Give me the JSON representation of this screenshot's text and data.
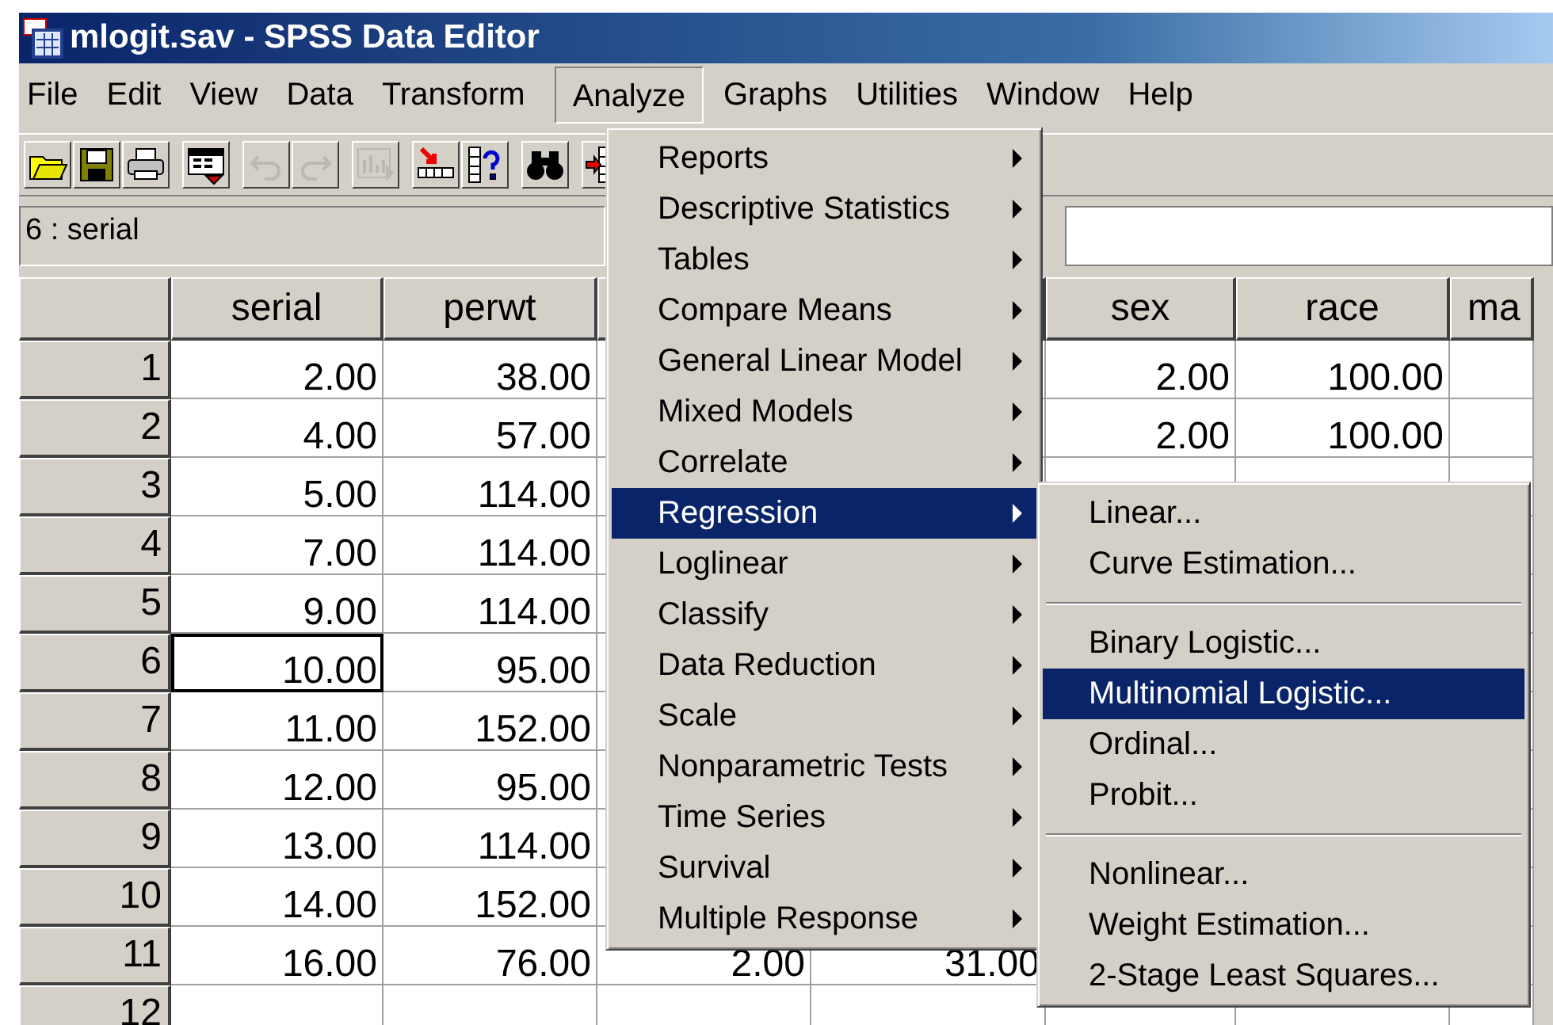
{
  "window": {
    "title": "mlogit.sav - SPSS Data Editor"
  },
  "menubar": [
    {
      "label": "File",
      "selected": false
    },
    {
      "label": "Edit",
      "selected": false
    },
    {
      "label": "View",
      "selected": false
    },
    {
      "label": "Data",
      "selected": false
    },
    {
      "label": "Transform",
      "selected": false
    },
    {
      "label": "Analyze",
      "selected": true
    },
    {
      "label": "Graphs",
      "selected": false
    },
    {
      "label": "Utilities",
      "selected": false
    },
    {
      "label": "Window",
      "selected": false
    },
    {
      "label": "Help",
      "selected": false
    }
  ],
  "toolbar": [
    {
      "kind": "open",
      "disabled": false
    },
    {
      "kind": "save",
      "disabled": false
    },
    {
      "kind": "print",
      "disabled": false
    },
    {
      "kind": "dialog",
      "disabled": false
    },
    {
      "kind": "undo",
      "disabled": true
    },
    {
      "kind": "redo",
      "disabled": true
    },
    {
      "kind": "chart",
      "disabled": true
    },
    {
      "kind": "goto",
      "disabled": false
    },
    {
      "kind": "variables",
      "disabled": false
    },
    {
      "kind": "find",
      "disabled": false
    },
    {
      "kind": "insert",
      "disabled": false
    }
  ],
  "cell_editor": {
    "reference": "6 : serial"
  },
  "grid": {
    "columns": [
      "serial",
      "perwt",
      null,
      null,
      "sex",
      "race",
      "ma"
    ],
    "rows": [
      {
        "label": "1",
        "focused": false,
        "cells": [
          "2.00",
          "38.00",
          null,
          null,
          "2.00",
          "100.00",
          null
        ]
      },
      {
        "label": "2",
        "focused": false,
        "cells": [
          "4.00",
          "57.00",
          null,
          null,
          "2.00",
          "100.00",
          null
        ]
      },
      {
        "label": "3",
        "focused": false,
        "cells": [
          "5.00",
          "114.00",
          null,
          null,
          null,
          null,
          null
        ]
      },
      {
        "label": "4",
        "focused": false,
        "cells": [
          "7.00",
          "114.00",
          null,
          null,
          null,
          null,
          null
        ]
      },
      {
        "label": "5",
        "focused": false,
        "cells": [
          "9.00",
          "114.00",
          null,
          null,
          null,
          null,
          null
        ]
      },
      {
        "label": "6",
        "focused": true,
        "cells": [
          "10.00",
          "95.00",
          null,
          null,
          null,
          null,
          null
        ]
      },
      {
        "label": "7",
        "focused": false,
        "cells": [
          "11.00",
          "152.00",
          null,
          null,
          null,
          null,
          null
        ]
      },
      {
        "label": "8",
        "focused": false,
        "cells": [
          "12.00",
          "95.00",
          null,
          null,
          null,
          null,
          null
        ]
      },
      {
        "label": "9",
        "focused": false,
        "cells": [
          "13.00",
          "114.00",
          null,
          null,
          null,
          null,
          null
        ]
      },
      {
        "label": "10",
        "focused": false,
        "cells": [
          "14.00",
          "152.00",
          null,
          null,
          null,
          null,
          null
        ]
      },
      {
        "label": "11",
        "focused": false,
        "cells": [
          "16.00",
          "76.00",
          "2.00",
          "31.00",
          null,
          null,
          null
        ]
      },
      {
        "label": "12",
        "focused": false,
        "cells": [
          null,
          null,
          null,
          null,
          null,
          null,
          null
        ]
      }
    ]
  },
  "analyze_menu": {
    "items": [
      {
        "kind": "item",
        "label": "Reports",
        "has_submenu": true,
        "selected": false
      },
      {
        "kind": "item",
        "label": "Descriptive Statistics",
        "has_submenu": true,
        "selected": false
      },
      {
        "kind": "item",
        "label": "Tables",
        "has_submenu": true,
        "selected": false
      },
      {
        "kind": "item",
        "label": "Compare Means",
        "has_submenu": true,
        "selected": false
      },
      {
        "kind": "item",
        "label": "General Linear Model",
        "has_submenu": true,
        "selected": false
      },
      {
        "kind": "item",
        "label": "Mixed Models",
        "has_submenu": true,
        "selected": false
      },
      {
        "kind": "item",
        "label": "Correlate",
        "has_submenu": true,
        "selected": false
      },
      {
        "kind": "item",
        "label": "Regression",
        "has_submenu": true,
        "selected": true
      },
      {
        "kind": "item",
        "label": "Loglinear",
        "has_submenu": true,
        "selected": false
      },
      {
        "kind": "item",
        "label": "Classify",
        "has_submenu": true,
        "selected": false
      },
      {
        "kind": "item",
        "label": "Data Reduction",
        "has_submenu": true,
        "selected": false
      },
      {
        "kind": "item",
        "label": "Scale",
        "has_submenu": true,
        "selected": false
      },
      {
        "kind": "item",
        "label": "Nonparametric Tests",
        "has_submenu": true,
        "selected": false
      },
      {
        "kind": "item",
        "label": "Time Series",
        "has_submenu": true,
        "selected": false
      },
      {
        "kind": "item",
        "label": "Survival",
        "has_submenu": true,
        "selected": false
      },
      {
        "kind": "item",
        "label": "Multiple Response",
        "has_submenu": true,
        "selected": false
      }
    ]
  },
  "regression_submenu": {
    "items": [
      {
        "kind": "item",
        "label": "Linear...",
        "has_submenu": false,
        "selected": false
      },
      {
        "kind": "item",
        "label": "Curve Estimation...",
        "has_submenu": false,
        "selected": false
      },
      {
        "kind": "separator"
      },
      {
        "kind": "item",
        "label": "Binary Logistic...",
        "has_submenu": false,
        "selected": false
      },
      {
        "kind": "item",
        "label": "Multinomial Logistic...",
        "has_submenu": false,
        "selected": true
      },
      {
        "kind": "item",
        "label": "Ordinal...",
        "has_submenu": false,
        "selected": false
      },
      {
        "kind": "item",
        "label": "Probit...",
        "has_submenu": false,
        "selected": false
      },
      {
        "kind": "separator"
      },
      {
        "kind": "item",
        "label": "Nonlinear...",
        "has_submenu": false,
        "selected": false
      },
      {
        "kind": "item",
        "label": "Weight Estimation...",
        "has_submenu": false,
        "selected": false
      },
      {
        "kind": "item",
        "label": "2-Stage Least Squares...",
        "has_submenu": false,
        "selected": false
      }
    ]
  }
}
